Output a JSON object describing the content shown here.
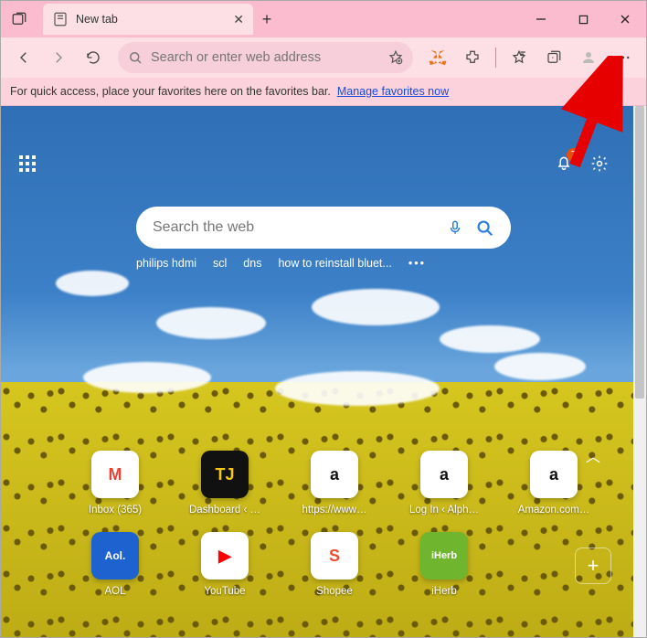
{
  "titlebar": {
    "tab_label": "New tab"
  },
  "toolbar": {
    "omnibox_placeholder": "Search or enter web address"
  },
  "favorites_bar": {
    "text": "For quick access, place your favorites here on the favorites bar.",
    "link": "Manage favorites now"
  },
  "ntp": {
    "bell_badge": "7",
    "search_placeholder": "Search the web",
    "trends": [
      "philips hdmi",
      "scl",
      "dns",
      "how to reinstall bluet..."
    ],
    "tiles_row1": [
      {
        "name": "Inbox (365)",
        "id": "gmail",
        "glyph": "M",
        "color": "#ea4335"
      },
      {
        "name": "Dashboard ‹ …",
        "id": "tj",
        "glyph": "TJ",
        "bg": "#111",
        "color": "#f5c518"
      },
      {
        "name": "https://www…",
        "id": "a1",
        "glyph": "a",
        "bg": "#fff",
        "color": "#111"
      },
      {
        "name": "Log In ‹ Alph…",
        "id": "a2",
        "glyph": "a",
        "bg": "#fff",
        "color": "#111"
      },
      {
        "name": "Amazon.com…",
        "id": "amazon",
        "glyph": "a",
        "bg": "#fff",
        "color": "#111"
      }
    ],
    "tiles_row2": [
      {
        "name": "AOL",
        "id": "aol",
        "glyph": "Aol.",
        "bg": "#1e62d0",
        "color": "#fff",
        "fs": "12px"
      },
      {
        "name": "YouTube",
        "id": "youtube",
        "glyph": "▶",
        "bg": "#fff",
        "color": "#ff0000"
      },
      {
        "name": "Shopee",
        "id": "shopee",
        "glyph": "S",
        "bg": "#fff",
        "color": "#ee4d2d"
      },
      {
        "name": "iHerb",
        "id": "iherb",
        "glyph": "iHerb",
        "bg": "#6fb62e",
        "color": "#fff",
        "fs": "11px"
      }
    ]
  },
  "colors": {
    "accent_pink": "#fbbcd0",
    "accent_pink_light": "#fce0e6",
    "link_blue": "#1a4bd9",
    "badge_orange": "#e25012",
    "search_blue": "#2a7de1"
  },
  "annotation": {
    "arrow_target": "settings-more-button"
  }
}
